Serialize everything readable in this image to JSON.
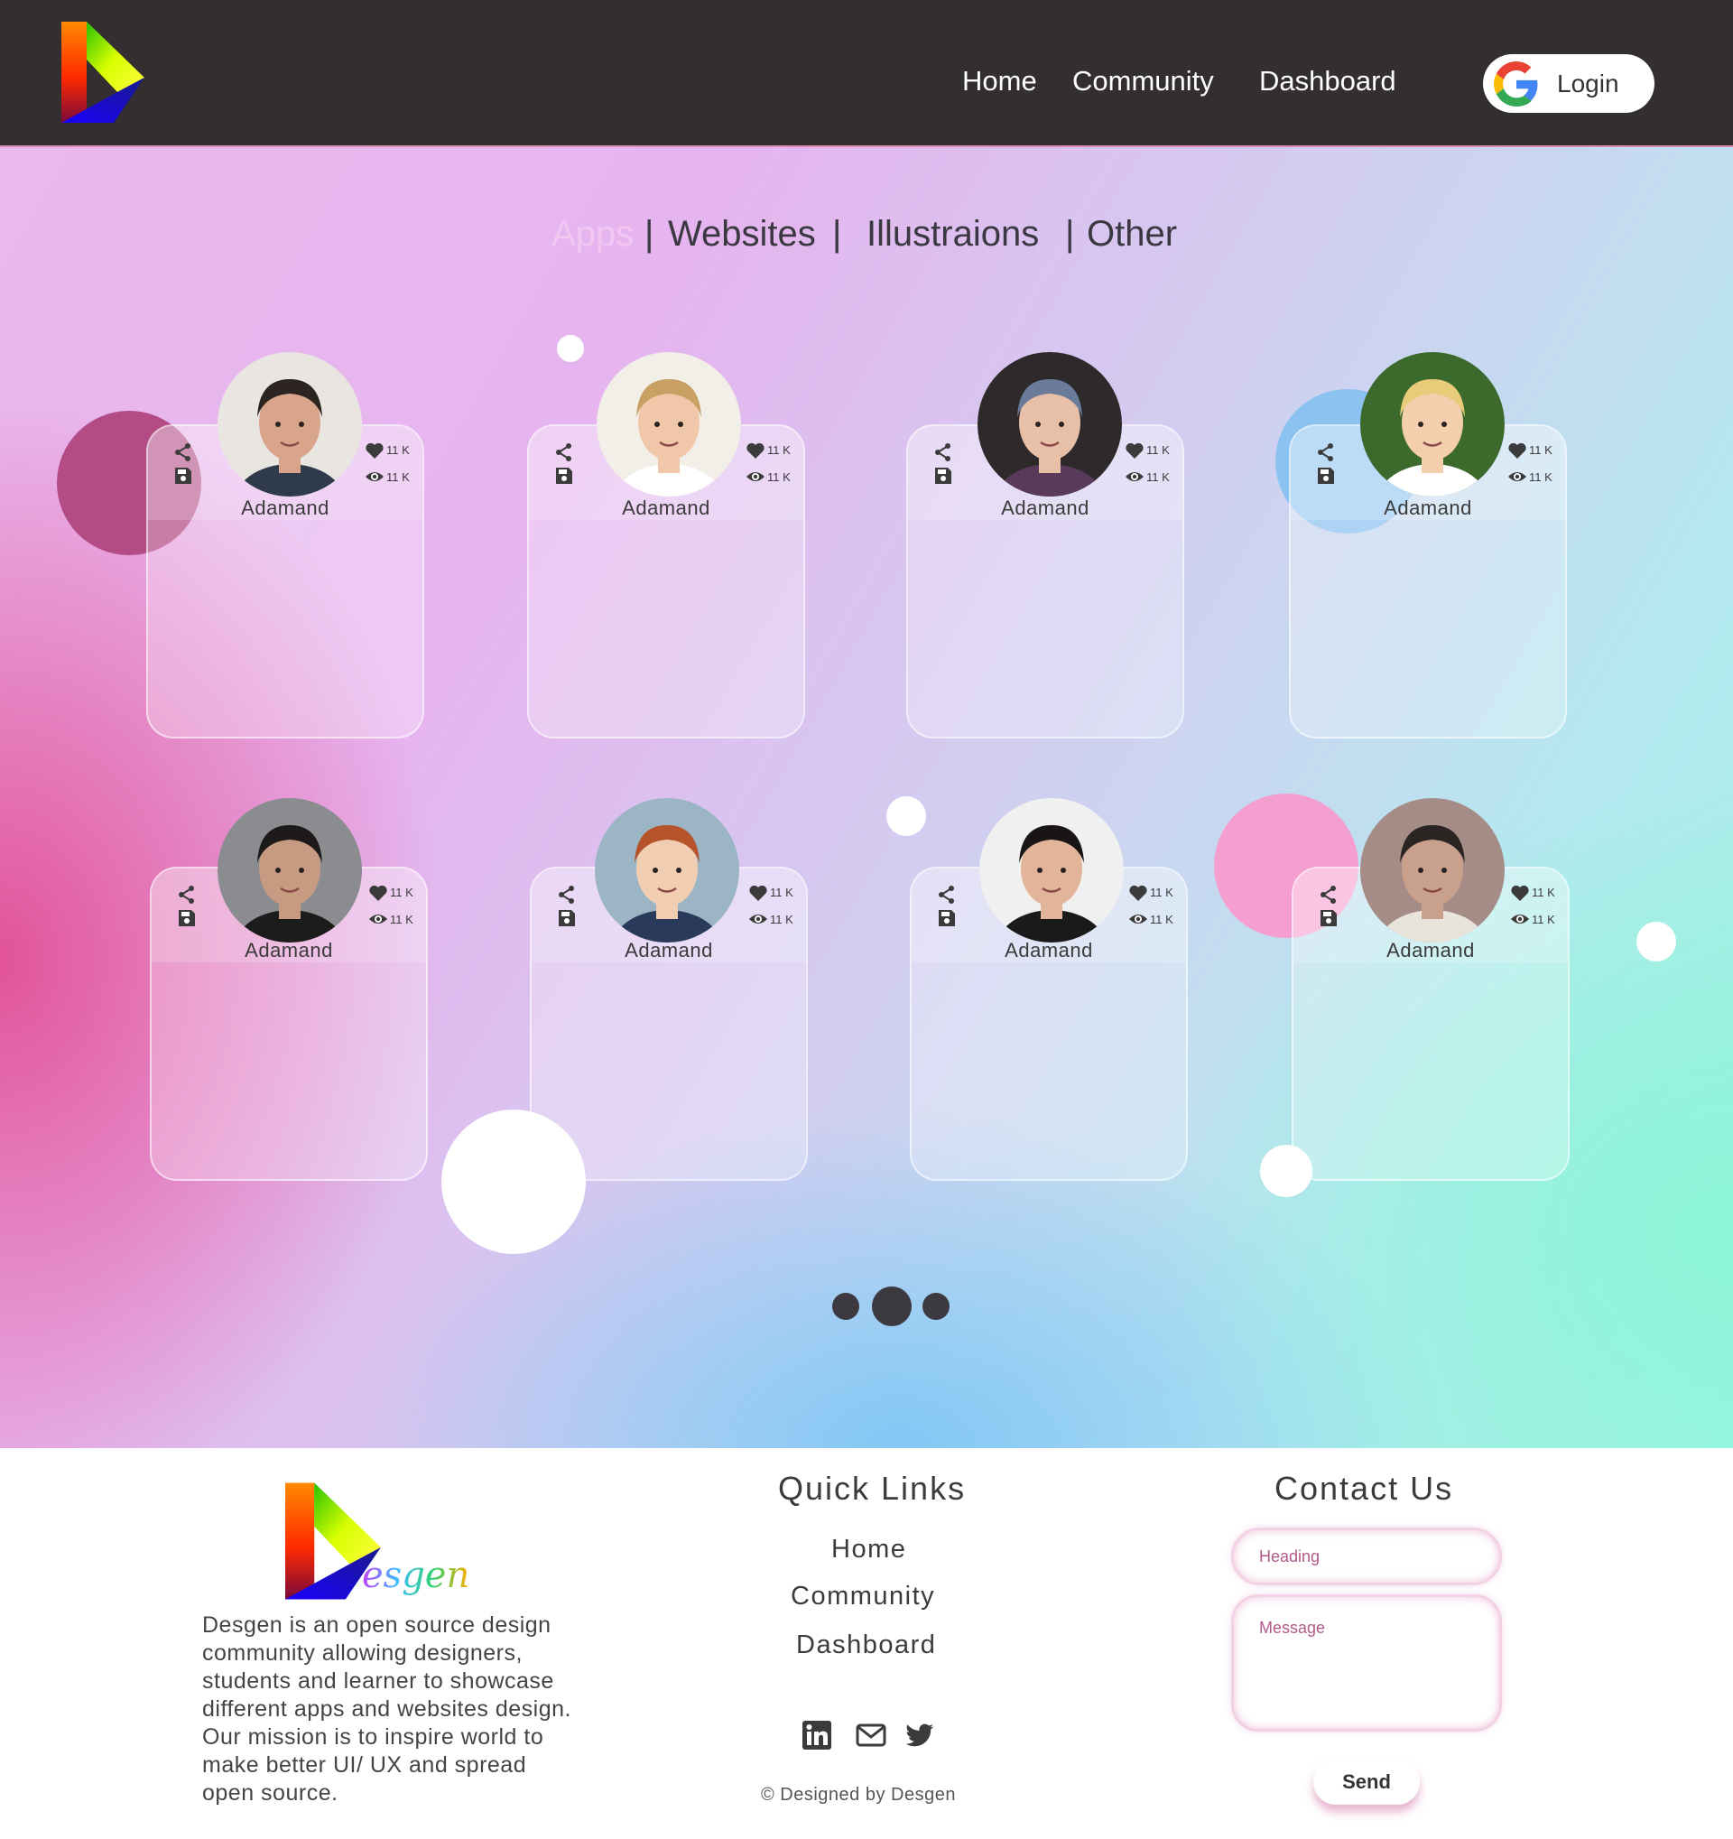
{
  "nav": {
    "links": [
      "Home",
      "Community",
      "Dashboard"
    ],
    "login_label": "Login"
  },
  "tabs": {
    "items": [
      "Apps",
      "Websites",
      "Illustraions",
      "Other"
    ],
    "active": "Apps",
    "separator": "|"
  },
  "cards": [
    {
      "name": "Adamand",
      "likes": "11 K",
      "views": "11 K"
    },
    {
      "name": "Adamand",
      "likes": "11 K",
      "views": "11 K"
    },
    {
      "name": "Adamand",
      "likes": "11 K",
      "views": "11 K"
    },
    {
      "name": "Adamand",
      "likes": "11 K",
      "views": "11 K"
    },
    {
      "name": "Adamand",
      "likes": "11 K",
      "views": "11 K"
    },
    {
      "name": "Adamand",
      "likes": "11 K",
      "views": "11 K"
    },
    {
      "name": "Adamand",
      "likes": "11 K",
      "views": "11 K"
    },
    {
      "name": "Adamand",
      "likes": "11 K",
      "views": "11 K"
    }
  ],
  "pagination": {
    "pages": 3,
    "current": 2
  },
  "footer": {
    "logo_text": "esgen",
    "description": "Desgen is an open source design community allowing designers, students and learner to showcase different apps and websites design. Our mission is to inspire world to make better UI/ UX and spread open source.",
    "quick_links_title": "Quick Links",
    "quick_links": [
      "Home",
      "Community",
      "Dashboard"
    ],
    "contact_title": "Contact Us",
    "heading_placeholder": "Heading",
    "message_placeholder": "Message",
    "send_label": "Send",
    "copyright": "© Designed by Desgen",
    "social_icons": [
      "linkedin-icon",
      "mail-icon",
      "twitter-icon"
    ]
  },
  "colors": {
    "nav_bg": "#332f30",
    "active_tab": "#f4c7f2",
    "text_dark": "#3b3b3b",
    "field_glow": "#d678aa"
  }
}
